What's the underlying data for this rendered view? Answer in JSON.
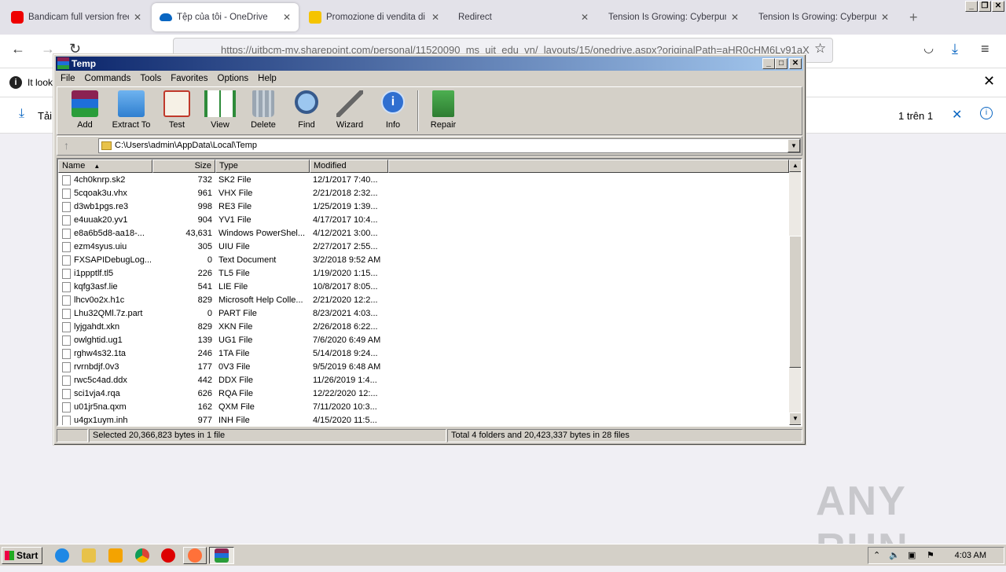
{
  "browser": {
    "tabs": [
      {
        "title": "Bandicam full version free d",
        "icon": "youtube-icon",
        "active": false
      },
      {
        "title": "Tệp của tôi - OneDrive",
        "icon": "onedrive-icon",
        "active": true
      },
      {
        "title": "Promozione di vendita di ne",
        "icon": "shop-icon",
        "active": false
      },
      {
        "title": "Redirect",
        "icon": "",
        "active": false
      },
      {
        "title": "Tension Is Growing: Cyberpunk",
        "icon": "",
        "active": false
      },
      {
        "title": "Tension Is Growing: Cyberpunk",
        "icon": "",
        "active": false
      }
    ],
    "new_tab": "+",
    "url": "https://uitbcm-my.sharepoint.com/personal/11520090_ms_uit_edu_vn/_layouts/15/onedrive.aspx?originalPath=aHR0cHM6Ly91aX",
    "info_text": "It look",
    "download_label": "Tải",
    "page_counter": "1 trên 1",
    "watermark": "ANY RUN"
  },
  "rar": {
    "title": "Temp",
    "menus": [
      "File",
      "Commands",
      "Tools",
      "Favorites",
      "Options",
      "Help"
    ],
    "tools": [
      {
        "label": "Add",
        "icon": "add-archive-icon"
      },
      {
        "label": "Extract To",
        "icon": "extract-folder-icon"
      },
      {
        "label": "Test",
        "icon": "test-clipboard-icon"
      },
      {
        "label": "View",
        "icon": "view-book-icon"
      },
      {
        "label": "Delete",
        "icon": "trash-icon"
      },
      {
        "label": "Find",
        "icon": "magnifier-icon"
      },
      {
        "label": "Wizard",
        "icon": "wand-icon"
      },
      {
        "label": "Info",
        "icon": "info-icon"
      },
      {
        "label": "Repair",
        "icon": "repair-icon"
      }
    ],
    "path": "C:\\Users\\admin\\AppData\\Local\\Temp",
    "columns": [
      "Name",
      "Size",
      "Type",
      "Modified"
    ],
    "files": [
      {
        "name": "4ch0knrp.sk2",
        "size": "732",
        "type": "SK2 File",
        "modified": "12/1/2017 7:40..."
      },
      {
        "name": "5cqoak3u.vhx",
        "size": "961",
        "type": "VHX File",
        "modified": "2/21/2018 2:32..."
      },
      {
        "name": "d3wb1pgs.re3",
        "size": "998",
        "type": "RE3 File",
        "modified": "1/25/2019 1:39..."
      },
      {
        "name": "e4uuak20.yv1",
        "size": "904",
        "type": "YV1 File",
        "modified": "4/17/2017 10:4..."
      },
      {
        "name": "e8a6b5d8-aa18-...",
        "size": "43,631",
        "type": "Windows PowerShel...",
        "modified": "4/12/2021 3:00..."
      },
      {
        "name": "ezm4syus.uiu",
        "size": "305",
        "type": "UIU File",
        "modified": "2/27/2017 2:55..."
      },
      {
        "name": "FXSAPIDebugLog...",
        "size": "0",
        "type": "Text Document",
        "modified": "3/2/2018 9:52 AM"
      },
      {
        "name": "i1ppptlf.tl5",
        "size": "226",
        "type": "TL5 File",
        "modified": "1/19/2020 1:15..."
      },
      {
        "name": "kqfg3asf.lie",
        "size": "541",
        "type": "LIE File",
        "modified": "10/8/2017 8:05..."
      },
      {
        "name": "lhcv0o2x.h1c",
        "size": "829",
        "type": "Microsoft Help Colle...",
        "modified": "2/21/2020 12:2..."
      },
      {
        "name": "Lhu32QMl.7z.part",
        "size": "0",
        "type": "PART File",
        "modified": "8/23/2021 4:03..."
      },
      {
        "name": "lyjgahdt.xkn",
        "size": "829",
        "type": "XKN File",
        "modified": "2/26/2018 6:22..."
      },
      {
        "name": "owlghtid.ug1",
        "size": "139",
        "type": "UG1 File",
        "modified": "7/6/2020 6:49 AM"
      },
      {
        "name": "rghw4s32.1ta",
        "size": "246",
        "type": "1TA File",
        "modified": "5/14/2018 9:24..."
      },
      {
        "name": "rvrnbdjf.0v3",
        "size": "177",
        "type": "0V3 File",
        "modified": "9/5/2019 6:48 AM"
      },
      {
        "name": "rwc5c4ad.ddx",
        "size": "442",
        "type": "DDX File",
        "modified": "11/26/2019 1:4..."
      },
      {
        "name": "sci1vja4.rqa",
        "size": "626",
        "type": "RQA File",
        "modified": "12/22/2020 12:..."
      },
      {
        "name": "u01jr5na.qxm",
        "size": "162",
        "type": "QXM File",
        "modified": "7/11/2020 10:3..."
      },
      {
        "name": "u4gx1uym.inh",
        "size": "977",
        "type": "INH File",
        "modified": "4/15/2020 11:5..."
      }
    ],
    "status_left": "Selected 20,366,823 bytes in 1 file",
    "status_right": "Total 4 folders and 20,423,337 bytes in 28 files"
  },
  "taskbar": {
    "start": "Start",
    "clock": "4:03 AM"
  }
}
